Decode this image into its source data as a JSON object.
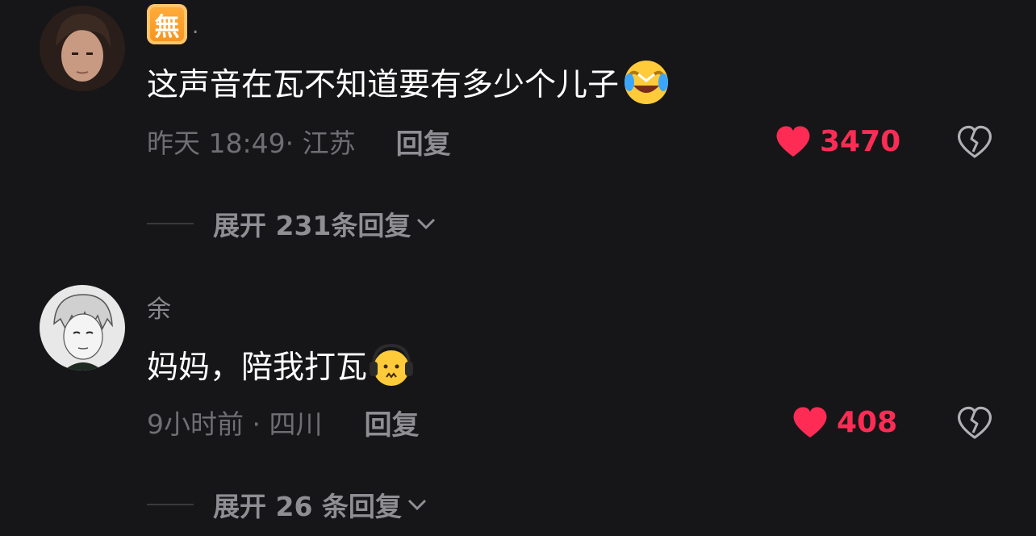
{
  "comments": [
    {
      "username_badge": "無",
      "username_suffix": ".",
      "text": "这声音在瓦不知道要有多少个儿子",
      "emoji": "laughing-crying-emoji",
      "meta": "昨天 18:49· 江苏",
      "reply_label": "回复",
      "likes": "3470",
      "expand_label": "展开 231条回复"
    },
    {
      "username": "余",
      "text": "妈妈，陪我打瓦",
      "emoji": "headphones-sad-emoji",
      "meta": "9小时前 · 四川",
      "reply_label": "回复",
      "likes": "408",
      "expand_label": "展开 26 条回复"
    }
  ],
  "colors": {
    "background": "#161618",
    "like_red": "#fe2c55",
    "muted_text": "#6e6e73"
  }
}
